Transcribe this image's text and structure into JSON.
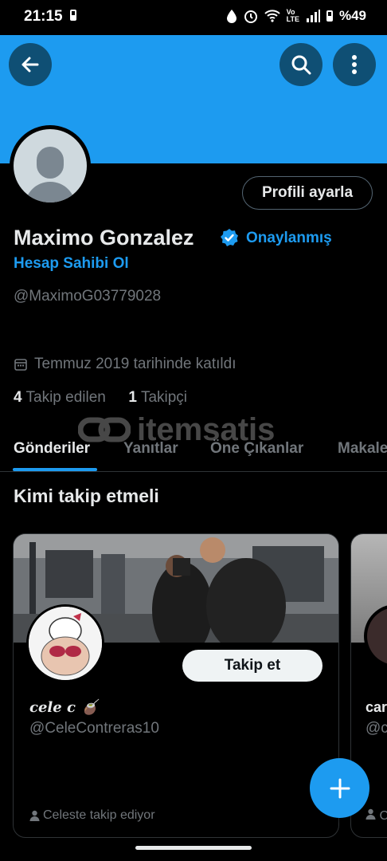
{
  "status_bar": {
    "time": "21:15",
    "battery": "%49",
    "icons": [
      "battery-icon",
      "water-drop-icon",
      "alarm-icon",
      "wifi-icon",
      "volte-icon",
      "signal-icon"
    ]
  },
  "header": {
    "back_icon": "arrow-left-icon",
    "search_icon": "search-icon",
    "more_icon": "more-vertical-icon",
    "banner_color": "#1d9bf0"
  },
  "profile": {
    "edit_button": "Profili ayarla",
    "name": "Maximo Gonzalez",
    "verified_label": "Onaylanmış",
    "owner_link": "Hesap Sahibi Ol",
    "handle": "@MaximoG03779028",
    "joined": "Temmuz 2019 tarihinde katıldı",
    "following_count": "4",
    "following_label": "Takip edilen",
    "followers_count": "1",
    "followers_label": "Takipçi"
  },
  "watermark": "itemsatis",
  "tabs": [
    {
      "label": "Gönderiler",
      "active": true
    },
    {
      "label": "Yanıtlar",
      "active": false
    },
    {
      "label": "Öne Çıkanlar",
      "active": false
    },
    {
      "label": "Makale",
      "active": false
    }
  ],
  "suggestions": {
    "title": "Kimi takip etmeli",
    "cards": [
      {
        "name": "cele c 🧉",
        "handle": "@CeleContreras10",
        "follow_label": "Takip et",
        "footer": "Celeste takip ediyor"
      },
      {
        "name": "car",
        "handle": "@c",
        "footer": "C"
      }
    ]
  },
  "fab_icon": "plus-icon",
  "colors": {
    "accent": "#1d9bf0",
    "background": "#000000",
    "muted_text": "#71767b"
  }
}
